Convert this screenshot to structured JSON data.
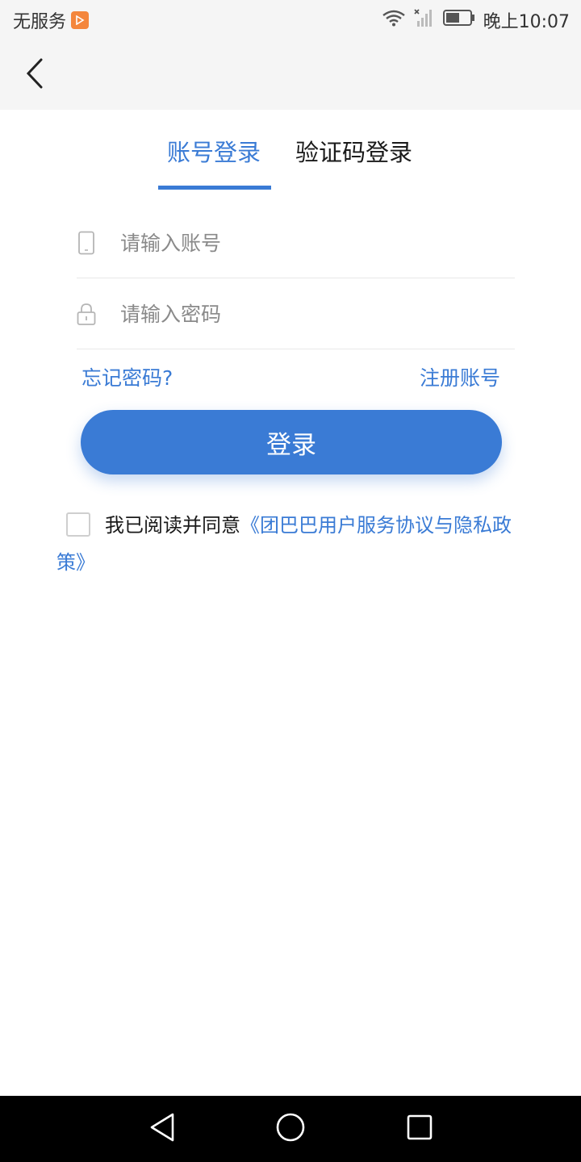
{
  "status_bar": {
    "carrier": "无服务",
    "time": "晚上10:07",
    "icons": [
      "wifi-icon",
      "signal-icon",
      "battery-icon"
    ]
  },
  "nav": {
    "back_icon": "chevron-left-icon"
  },
  "tabs": [
    {
      "label": "账号登录",
      "active": true
    },
    {
      "label": "验证码登录",
      "active": false
    }
  ],
  "form": {
    "account_placeholder": "请输入账号",
    "password_placeholder": "请输入密码",
    "account_value": "",
    "password_value": ""
  },
  "links": {
    "forgot_password": "忘记密码?",
    "register": "注册账号"
  },
  "login_button": "登录",
  "agreement": {
    "checked": false,
    "prefix": "我已阅读并同意",
    "policy": "《团巴巴用户服务协议与隐私政策》"
  },
  "colors": {
    "accent": "#3a7bd5",
    "status_bar_bg": "#f5f5f5",
    "nav_bar_bg": "#000000"
  }
}
